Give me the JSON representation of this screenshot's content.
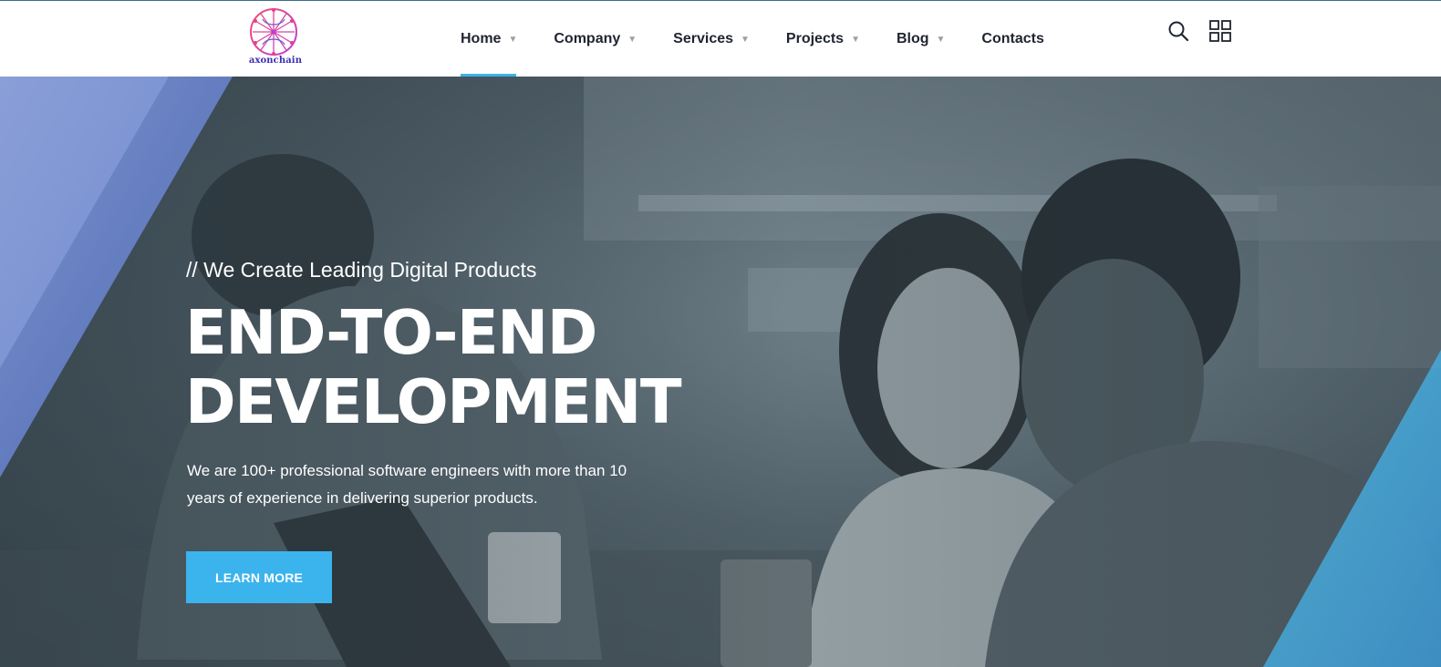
{
  "brand": {
    "logo_text": "axonchain"
  },
  "nav": {
    "items": [
      {
        "label": "Home",
        "has_dropdown": true,
        "active": true
      },
      {
        "label": "Company",
        "has_dropdown": true,
        "active": false
      },
      {
        "label": "Services",
        "has_dropdown": true,
        "active": false
      },
      {
        "label": "Projects",
        "has_dropdown": true,
        "active": false
      },
      {
        "label": "Blog",
        "has_dropdown": true,
        "active": false
      },
      {
        "label": "Contacts",
        "has_dropdown": false,
        "active": false
      }
    ],
    "caret": "▼"
  },
  "header_icons": [
    "search-icon",
    "grid-menu-icon"
  ],
  "hero": {
    "kicker": "// We Create Leading Digital Products",
    "title_line1": "END-TO-END",
    "title_line2": "DEVELOPMENT",
    "description": "We are 100+ professional software engineers with more than 10 years of experience in delivering superior products.",
    "cta_label": "LEARN MORE"
  },
  "colors": {
    "accent": "#3bb4ed",
    "nav_text": "#1f2430",
    "logo_brain": "#e83e8c",
    "logo_text": "#3a2fb4"
  }
}
